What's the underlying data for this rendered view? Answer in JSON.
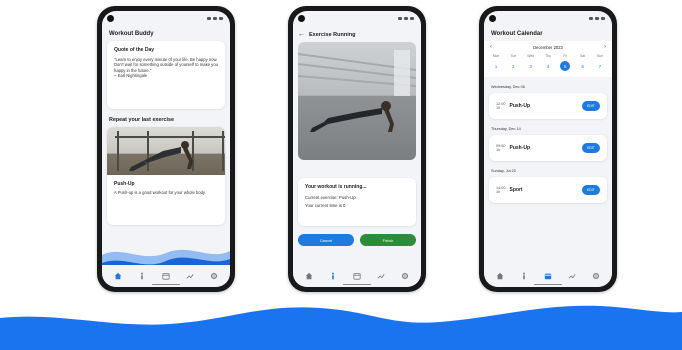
{
  "colors": {
    "primary": "#1f7ae0",
    "finish": "#2e8b3a",
    "wave": "#1a74f0",
    "phone": "#18191b"
  },
  "phone1": {
    "app_title": "Workout Buddy",
    "quote": {
      "title": "Quote of the Day",
      "text": "\"Learn to enjoy every minute of your life. Be happy now. Don't wait for something outside of yourself to make you happy in the future.\"",
      "author": "~ Earl Nightingale"
    },
    "repeat_title": "Repeat your last exercise",
    "exercise": {
      "name": "Push-Up",
      "description": "A Push-up is a good workout for your whole body."
    }
  },
  "phone2": {
    "title": "Exercise Running",
    "running_title": "Your workout is running...",
    "current_exercise": "Current exercise: Push-Up",
    "current_time": "Your current time is 0",
    "cancel_label": "Cancel",
    "finish_label": "Finish"
  },
  "phone3": {
    "title": "Workout Calendar",
    "month": "December 2023",
    "weekdays": [
      "Mon",
      "Tue",
      "Wed",
      "Thu",
      "Fri",
      "Sat",
      "Sun"
    ],
    "days": [
      "1",
      "2",
      "3",
      "4",
      "5",
      "6",
      "7"
    ],
    "selected_index": 4,
    "sections": [
      {
        "date": "Wednesday, Dec 06",
        "time": "12:00",
        "duration": "1h",
        "name": "Push-Up",
        "action": "EDIT"
      },
      {
        "date": "Thursday, Dec 14",
        "time": "09:50",
        "duration": "1h",
        "name": "Push-Up",
        "action": "EDIT"
      },
      {
        "date": "Sunday, Jul 20",
        "time": "14:00",
        "duration": "1h",
        "name": "Sport",
        "action": "EDIT"
      }
    ]
  }
}
